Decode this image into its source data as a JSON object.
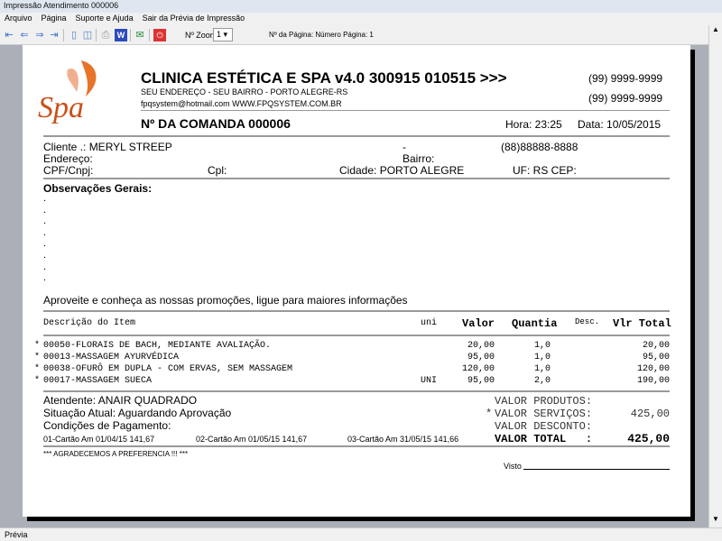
{
  "window": {
    "title": "Impressão Atendimento 000006"
  },
  "menu": [
    "Arquivo",
    "Página",
    "Suporte e Ajuda",
    "Sair da Prévia de Impressão"
  ],
  "toolbar": {
    "zoom_label": "Nº Zoom",
    "zoom_value": "1",
    "page_info": "Nº da Página: Número Página: 1"
  },
  "status": "Prévia",
  "report": {
    "logo_text": "Spa",
    "company": "CLINICA ESTÉTICA E SPA v4.0 300915 010515 >>>",
    "address": "SEU ENDEREÇO - SEU BAIRRO - PORTO ALEGRE-RS",
    "contact": "fpqsystem@hotmail.com  WWW.FPQSYSTEM.COM.BR",
    "phone1": "(99) 9999-9999",
    "phone2": "(99) 9999-9999",
    "comanda": "Nº DA COMANDA 000006",
    "hora": "Hora: 23:25",
    "data": "Data: 10/05/2015",
    "cliente": "Cliente   .: MERYL STREEP",
    "dash": "-",
    "cliente_phone": "(88)88888-8888",
    "endereco": "Endereço:",
    "bairro": "Bairro:",
    "cpf": "CPF/Cnpj:",
    "cpl": "Cpl:",
    "cidade": "Cidade: PORTO ALEGRE",
    "uf": "UF: RS  CEP:",
    "obs_title": "Observações Gerais:",
    "obs_dot": ".",
    "promo": "Aproveite e conheça as nossas promoções, ligue para maiores informações",
    "columns": {
      "desc": "Descrição do Item",
      "uni": "uni",
      "valor": "Valor",
      "quantia": "Quantia",
      "descto": "Desc.",
      "total": "Vlr Total"
    },
    "items": [
      {
        "mark": "*",
        "desc": "00050-FLORAIS DE BACH, MEDIANTE AVALIAÇÃO.",
        "uni": "",
        "valor": "20,00",
        "qtd": "1,0",
        "total": "20,00"
      },
      {
        "mark": "*",
        "desc": "00013-MASSAGEM AYURVÉDICA",
        "uni": "",
        "valor": "95,00",
        "qtd": "1,0",
        "total": "95,00"
      },
      {
        "mark": "*",
        "desc": "00038-OFURÔ EM DUPLA - COM ERVAS, SEM MASSAGEM",
        "uni": "",
        "valor": "120,00",
        "qtd": "1,0",
        "total": "120,00"
      },
      {
        "mark": "*",
        "desc": "00017-MASSAGEM SUECA",
        "uni": "UNI",
        "valor": "95,00",
        "qtd": "2,0",
        "total": "190,00"
      }
    ],
    "atendente": "Atendente: ANAIR QUADRADO",
    "situacao": "Situação Atual: Aguardando Aprovação",
    "condicoes": "Condições de Pagamento:",
    "payments": [
      "01-Cartão Am 01/04/15   141,67",
      "02-Cartão Am 01/05/15   141,67",
      "03-Cartão Am 31/05/15   141,66"
    ],
    "totals": {
      "produtos_label": "VALOR PRODUTOS:",
      "servicos_mark": "*",
      "servicos_label": "VALOR SERVIÇOS:",
      "servicos_value": "425,00",
      "desconto_label": "VALOR DESCONTO:",
      "total_label": "VALOR TOTAL   :",
      "total_value": "425,00"
    },
    "footer": "*** AGRADECEMOS A PREFERENCIA !!! ***",
    "visto": "Visto"
  }
}
